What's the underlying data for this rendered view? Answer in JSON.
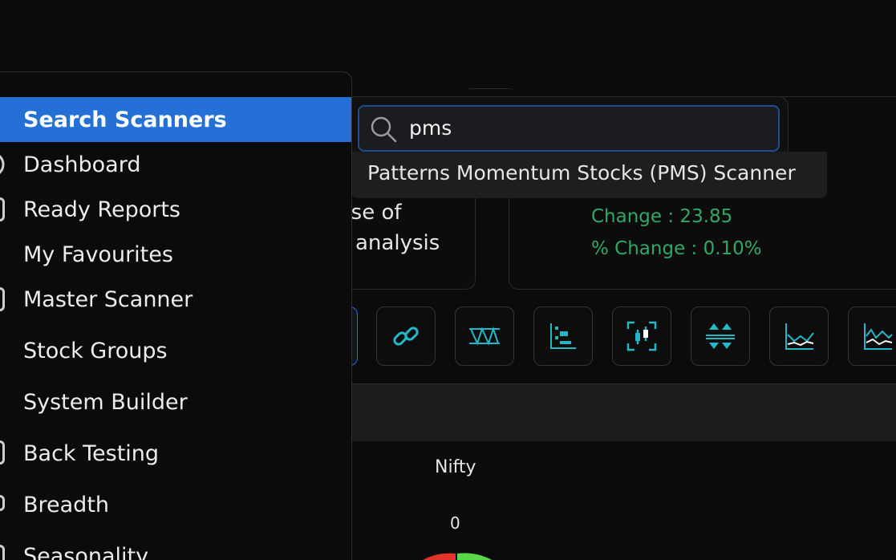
{
  "sidebar": {
    "items": [
      {
        "label": "Search Scanners",
        "active": true
      },
      {
        "label": "Dashboard"
      },
      {
        "label": "Ready Reports"
      },
      {
        "label": "My Favourites"
      },
      {
        "label": "Master Scanner"
      },
      {
        "label": "Stock Groups"
      },
      {
        "label": "System Builder"
      },
      {
        "label": "Back Testing"
      },
      {
        "label": "Breadth"
      },
      {
        "label": "Seasonality"
      }
    ]
  },
  "search": {
    "value": "pms",
    "results": [
      "Patterns Momentum Stocks (PMS) Scanner"
    ]
  },
  "background": {
    "left_card_lines": [
      "erse of",
      "analysis"
    ],
    "change": "Change     : 23.85",
    "pct_change": "% Change : 0.10%",
    "chart_title": "Nifty",
    "chart_value": "0"
  },
  "toolbar": {
    "icons": [
      "link-icon",
      "zigzag-icon",
      "bar-distribution-icon",
      "candlestick-focus-icon",
      "arrows-up-down-icon",
      "line-chart-icon",
      "area-chart-icon"
    ]
  },
  "colors": {
    "accent": "#2470d6",
    "positive": "#2fa866",
    "icon_teal": "#22b8c8"
  }
}
